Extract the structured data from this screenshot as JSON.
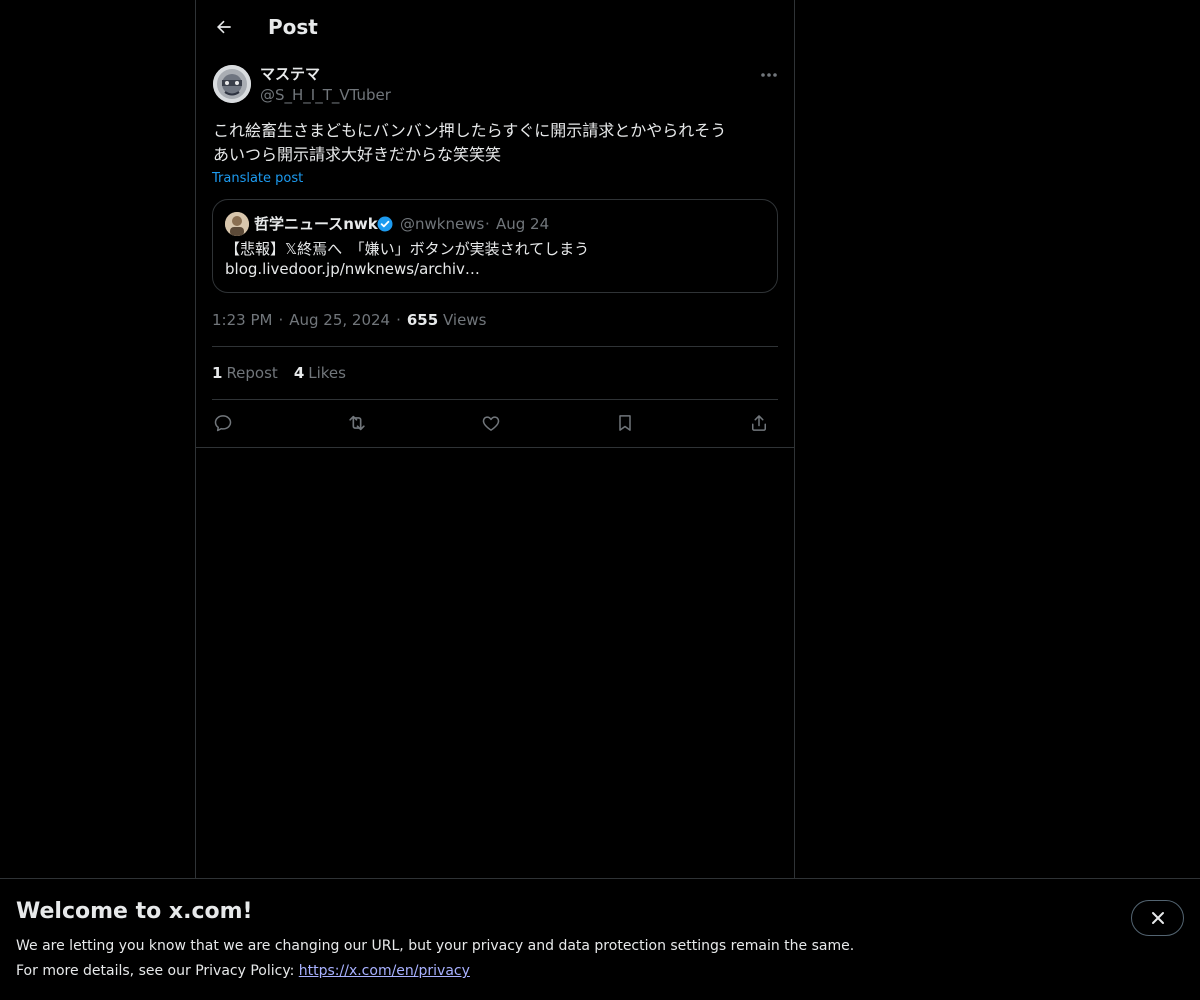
{
  "header": {
    "title": "Post",
    "back_icon": "arrow-left-icon"
  },
  "post": {
    "author": {
      "display_name": "マステマ",
      "handle": "@S_H_I_T_VTuber"
    },
    "text": "これ絵畜生さまどもにバンバン押したらすぐに開示請求とかやられそう\nあいつら開示請求大好きだからな笑笑笑",
    "translate_label": "Translate post",
    "quote": {
      "display_name": "哲学ニュースnwk",
      "handle": "@nwknews",
      "separator": "·",
      "date": "Aug 24",
      "text": "【悲報】𝕏終焉へ　「嫌い」ボタンが実装されてしまう\nblog.livedoor.jp/nwknews/archiv…"
    },
    "meta": {
      "time": "1:23 PM",
      "separator": "·",
      "date": "Aug 25, 2024",
      "views_count": "655",
      "views_label": "Views"
    },
    "stats": {
      "reposts_count": "1",
      "reposts_label": "Repost",
      "likes_count": "4",
      "likes_label": "Likes"
    },
    "actions": [
      "reply-icon",
      "repost-icon",
      "like-icon",
      "bookmark-icon",
      "share-icon"
    ]
  },
  "banner": {
    "title": "Welcome to x.com!",
    "line1": "We are letting you know that we are changing our URL, but your privacy and data protection settings remain the same.",
    "line2_prefix": "For more details, see our Privacy Policy: ",
    "link_text": "https://x.com/en/privacy"
  },
  "colors": {
    "background": "#000000",
    "text_primary": "#e7e9ea",
    "text_secondary": "#71767b",
    "accent": "#1d9bf0",
    "border": "#2f3336",
    "link": "#a8b1ff"
  }
}
